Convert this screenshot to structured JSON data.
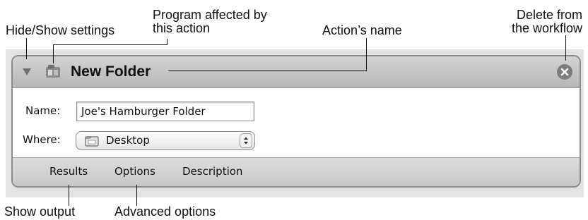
{
  "callouts": {
    "hide_show": "Hide/Show settings",
    "program_line1": "Program affected by",
    "program_line2": "this action",
    "action_name": "Action’s name",
    "delete_line1": "Delete from",
    "delete_line2": "the workflow",
    "show_output": "Show output",
    "advanced_options": "Advanced options"
  },
  "action": {
    "title": "New Folder",
    "disclosure_icon": "triangle-down-icon",
    "app_icon": "finder-icon",
    "close_icon": "close-x-icon"
  },
  "fields": {
    "name_label": "Name:",
    "name_value": "Joe's Hamburger Folder",
    "where_label": "Where:",
    "where_value": "Desktop",
    "where_icon": "folder-icon"
  },
  "tabs": [
    "Results",
    "Options",
    "Description"
  ]
}
